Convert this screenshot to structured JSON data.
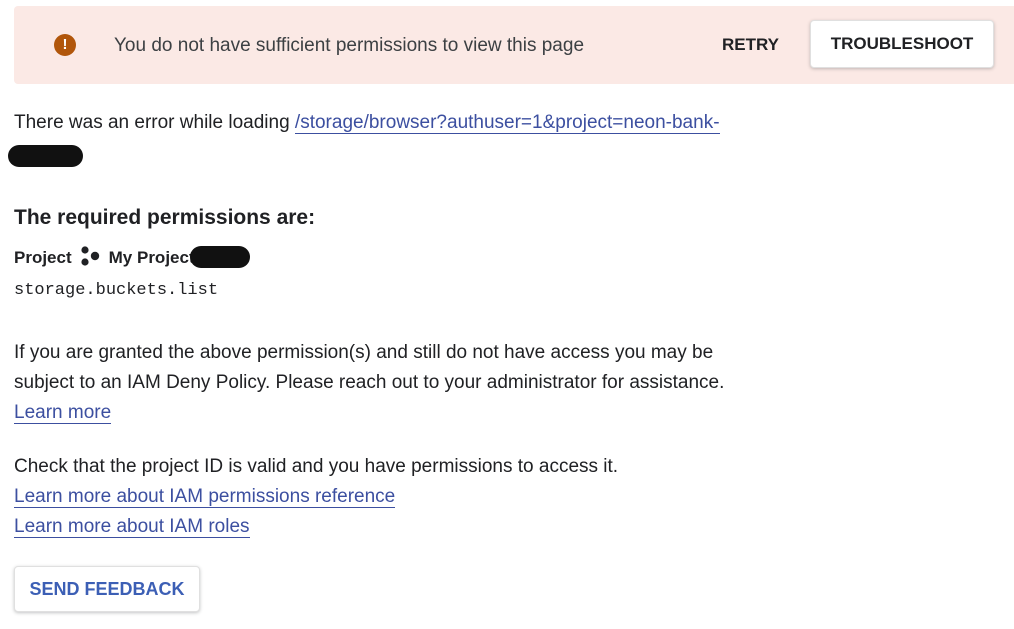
{
  "banner": {
    "message": "You do not have sufficient permissions to view this page",
    "retry_label": "RETRY",
    "troubleshoot_label": "TROUBLESHOOT",
    "icon": "warning-exclamation-icon",
    "icon_glyph": "!"
  },
  "error": {
    "prefix": "There was an error while loading",
    "url": "/storage/browser?authuser=1&project=neon-bank-"
  },
  "permissions": {
    "heading": "The required permissions are:",
    "scope_label": "Project",
    "project_icon": "project-hexagon-icon",
    "project_name": "My Project",
    "permission": "storage.buckets.list"
  },
  "deny_policy": {
    "line1": "If you are granted the above permission(s) and still do not have access you may be",
    "line2": "subject to an IAM Deny Policy. Please reach out to your administrator for assistance.",
    "learn_more": "Learn more"
  },
  "check": {
    "text": "Check that the project ID is valid and you have permissions to access it.",
    "link_permissions": "Learn more about IAM permissions reference",
    "link_roles": "Learn more about IAM roles"
  },
  "feedback": {
    "label": "SEND FEEDBACK"
  },
  "colors": {
    "banner_bg": "#fbe9e5",
    "warning": "#b1560b",
    "link": "#3c4fa0",
    "feedback_text": "#3c5fb5"
  }
}
